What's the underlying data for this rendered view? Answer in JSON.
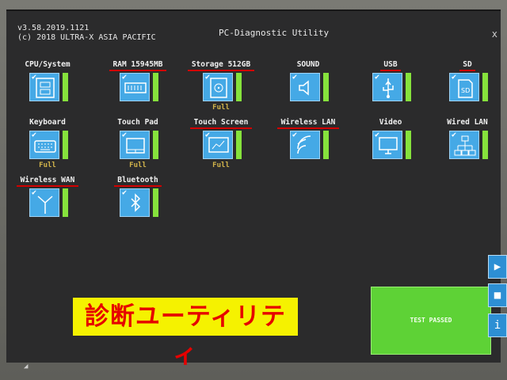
{
  "header": {
    "version": "v3.58.2019.1121",
    "copyright": "(c) 2018 ULTRA-X ASIA PACIFIC",
    "title": "PC-Diagnostic Utility",
    "close": "x"
  },
  "tiles": [
    {
      "label": "CPU/System",
      "icon": "cpu-icon",
      "status": "",
      "underline": false
    },
    {
      "label": "RAM 15945MB",
      "icon": "ram-icon",
      "status": "",
      "underline": true
    },
    {
      "label": "Storage 512GB",
      "icon": "storage-icon",
      "status": "Full",
      "underline": true
    },
    {
      "label": "SOUND",
      "icon": "speaker-icon",
      "status": "",
      "underline": false
    },
    {
      "label": "USB",
      "icon": "usb-icon",
      "status": "",
      "underline": true
    },
    {
      "label": "SD",
      "icon": "sd-card-icon",
      "status": "",
      "underline": true
    },
    {
      "label": "Keyboard",
      "icon": "keyboard-icon",
      "status": "Full",
      "underline": false
    },
    {
      "label": "Touch Pad",
      "icon": "touchpad-icon",
      "status": "Full",
      "underline": false
    },
    {
      "label": "Touch Screen",
      "icon": "touchscreen-icon",
      "status": "Full",
      "underline": true
    },
    {
      "label": "Wireless LAN",
      "icon": "wifi-icon",
      "status": "",
      "underline": true
    },
    {
      "label": "Video",
      "icon": "monitor-icon",
      "status": "",
      "underline": false
    },
    {
      "label": "Wired LAN",
      "icon": "network-icon",
      "status": "",
      "underline": false
    },
    {
      "label": "Wireless WAN",
      "icon": "antenna-icon",
      "status": "",
      "underline": true
    },
    {
      "label": "Bluetooth",
      "icon": "bluetooth-icon",
      "status": "",
      "underline": true
    }
  ],
  "overlay_text": "診断ユーティリティ",
  "result": "TEST PASSED",
  "side_buttons": [
    {
      "name": "next-icon",
      "glyph": "▶"
    },
    {
      "name": "stop-icon",
      "glyph": "■"
    },
    {
      "name": "info-icon",
      "glyph": "i"
    }
  ],
  "colors": {
    "tile": "#45a9e6",
    "bar": "#86e23c",
    "passed": "#5ed236",
    "underline": "#d20000",
    "banner_bg": "#f5f200",
    "banner_text": "#e60000"
  }
}
